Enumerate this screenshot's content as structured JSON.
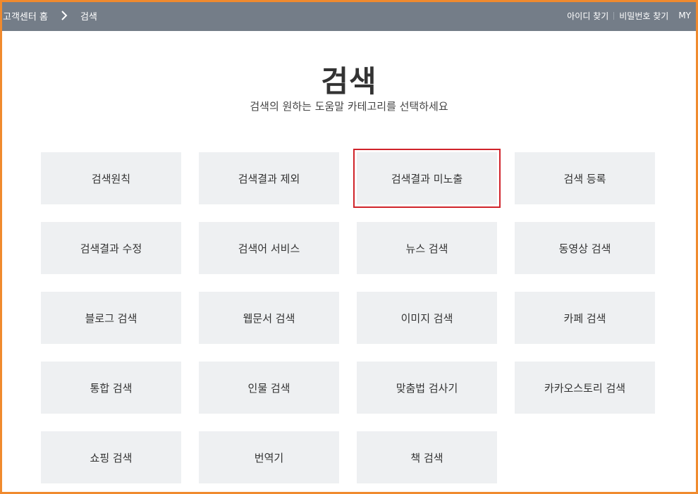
{
  "header": {
    "breadcrumb_home": "고객센터 홈",
    "breadcrumb_current": "검색",
    "nav": {
      "find_id": "아이디 찾기",
      "find_password": "비밀번호 찾기",
      "my": "MY"
    }
  },
  "page": {
    "title": "검색",
    "subtitle": "검색의 원하는 도움말 카테고리를 선택하세요"
  },
  "categories": [
    "검색원칙",
    "검색결과 제외",
    "검색결과 미노출",
    "검색 등록",
    "검색결과 수정",
    "검색어 서비스",
    "뉴스 검색",
    "동영상 검색",
    "블로그 검색",
    "웹문서 검색",
    "이미지 검색",
    "카페 검색",
    "통합 검색",
    "인물 검색",
    "맞춤법 검사기",
    "카카오스토리 검색",
    "쇼핑 검색",
    "번역기",
    "책 검색"
  ],
  "highlighted_category": "검색결과 미노출",
  "colors": {
    "header_bg": "#747d88",
    "tile_bg": "#eef0f2",
    "highlight_border": "#d0232a",
    "page_border": "#f08a2e"
  }
}
